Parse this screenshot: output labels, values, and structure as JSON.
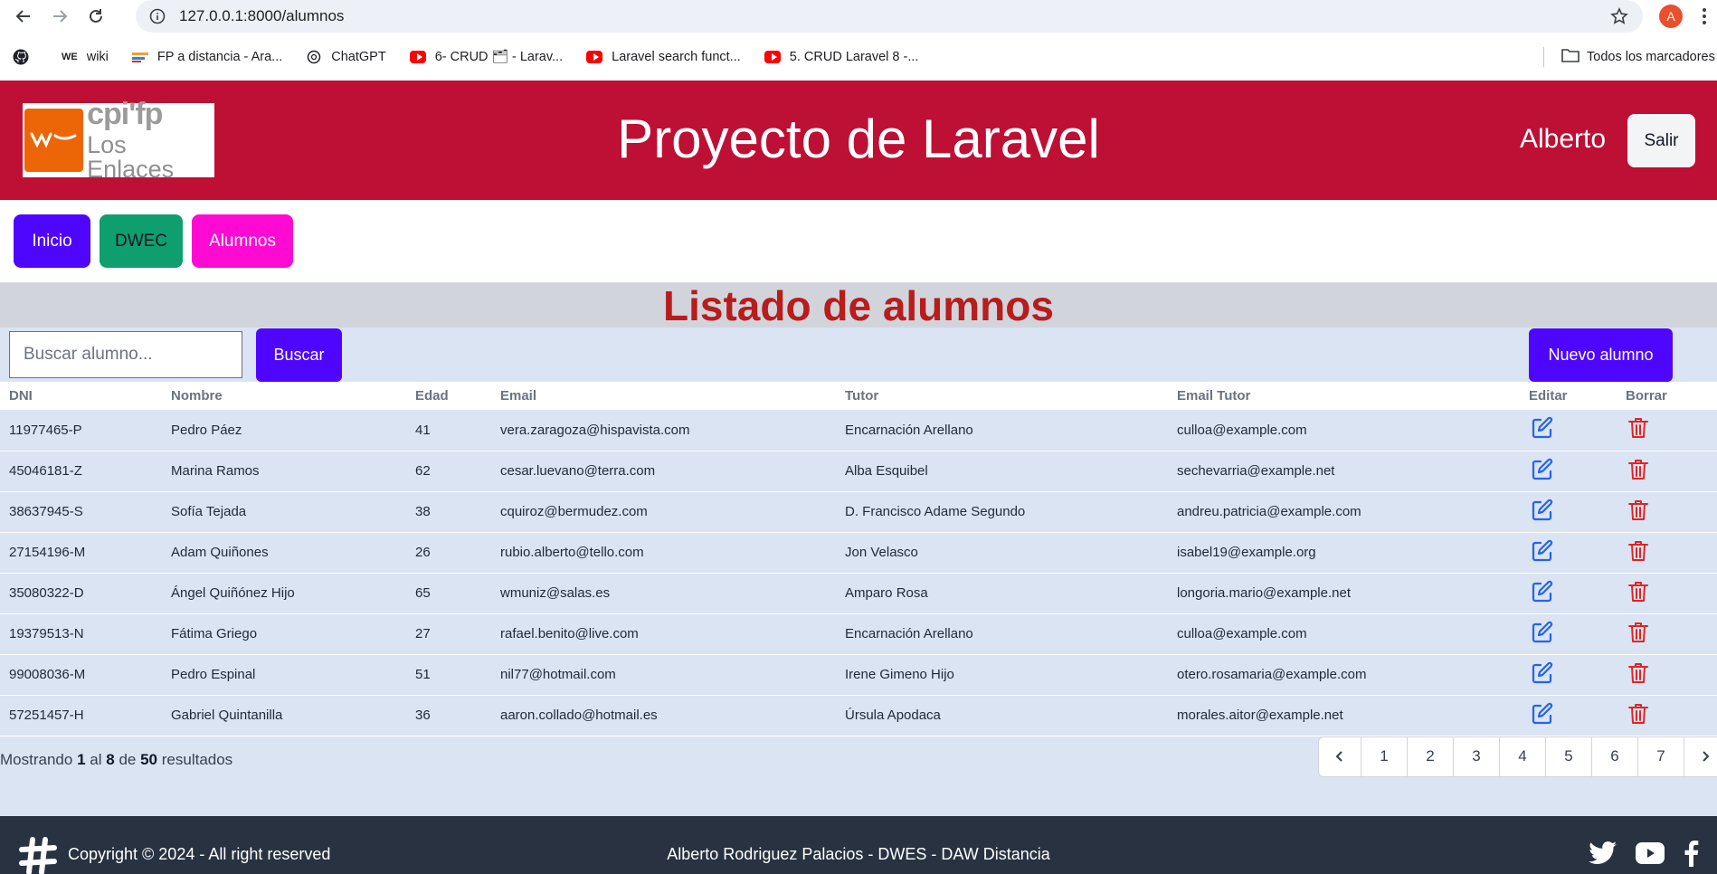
{
  "browser": {
    "url": "127.0.0.1:8000/alumnos",
    "profile_initial": "A",
    "bookmarks": [
      {
        "label": "",
        "icon": "github-icon"
      },
      {
        "label": "wiki",
        "icon": "we-icon"
      },
      {
        "label": "FP a distancia - Ara...",
        "icon": "fp-icon"
      },
      {
        "label": "ChatGPT",
        "icon": "chatgpt-icon"
      },
      {
        "label": "6- CRUD 🗂 - Larav...",
        "icon": "youtube-icon"
      },
      {
        "label": "Laravel search funct...",
        "icon": "youtube-icon"
      },
      {
        "label": "5. CRUD Laravel 8 -...",
        "icon": "youtube-icon"
      }
    ],
    "all_bookmarks": "Todos los marcadores"
  },
  "header": {
    "logo_line1": "cpi'fp",
    "logo_line2": "Los Enlaces",
    "title": "Proyecto de Laravel",
    "user": "Alberto",
    "logout_label": "Salir",
    "color": "#be0f34"
  },
  "nav": {
    "inicio": "Inicio",
    "dwec": "DWEC",
    "alumnos": "Alumnos"
  },
  "section": {
    "title": "Listado de alumnos",
    "search_placeholder": "Buscar alumno...",
    "search_label": "Buscar",
    "new_label": "Nuevo alumno"
  },
  "table": {
    "headers": [
      "DNI",
      "Nombre",
      "Edad",
      "Email",
      "Tutor",
      "Email Tutor",
      "Editar",
      "Borrar"
    ],
    "rows": [
      [
        "11977465-P",
        "Pedro Páez",
        "41",
        "vera.zaragoza@hispavista.com",
        "Encarnación Arellano",
        "culloa@example.com"
      ],
      [
        "45046181-Z",
        "Marina Ramos",
        "62",
        "cesar.luevano@terra.com",
        "Alba Esquibel",
        "sechevarria@example.net"
      ],
      [
        "38637945-S",
        "Sofía Tejada",
        "38",
        "cquiroz@bermudez.com",
        "D. Francisco Adame Segundo",
        "andreu.patricia@example.com"
      ],
      [
        "27154196-M",
        "Adam Quiñones",
        "26",
        "rubio.alberto@tello.com",
        "Jon Velasco",
        "isabel19@example.org"
      ],
      [
        "35080322-D",
        "Ángel Quiñónez Hijo",
        "65",
        "wmuniz@salas.es",
        "Amparo Rosa",
        "longoria.mario@example.net"
      ],
      [
        "19379513-N",
        "Fátima Griego",
        "27",
        "rafael.benito@live.com",
        "Encarnación Arellano",
        "culloa@example.com"
      ],
      [
        "99008036-M",
        "Pedro Espinal",
        "51",
        "nil77@hotmail.com",
        "Irene Gimeno Hijo",
        "otero.rosamaria@example.com"
      ],
      [
        "57251457-H",
        "Gabriel Quintanilla",
        "36",
        "aaron.collado@hotmail.es",
        "Úrsula Apodaca",
        "morales.aitor@example.net"
      ]
    ]
  },
  "pagination": {
    "showing": "Mostrando",
    "from": "1",
    "al": "al",
    "to": "8",
    "de": "de",
    "total": "50",
    "resultados": "resultados",
    "pages": [
      "1",
      "2",
      "3",
      "4",
      "5",
      "6",
      "7"
    ]
  },
  "footer": {
    "copyright": "Copyright © 2024 - All right reserved",
    "author": "Alberto Rodriguez Palacios - DWES - DAW Distancia"
  }
}
